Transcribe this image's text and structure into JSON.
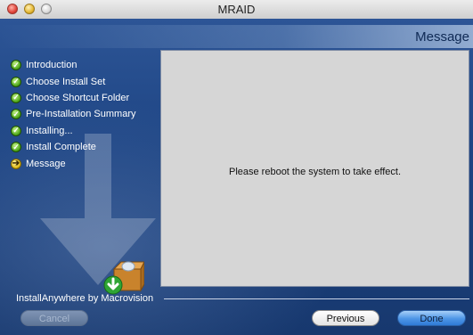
{
  "window": {
    "title": "MRAID"
  },
  "header": {
    "title": "Message"
  },
  "steps": [
    {
      "label": "Introduction",
      "state": "done"
    },
    {
      "label": "Choose Install Set",
      "state": "done"
    },
    {
      "label": "Choose Shortcut Folder",
      "state": "done"
    },
    {
      "label": "Pre-Installation Summary",
      "state": "done"
    },
    {
      "label": "Installing...",
      "state": "done"
    },
    {
      "label": "Install Complete",
      "state": "done"
    },
    {
      "label": "Message",
      "state": "current"
    }
  ],
  "content": {
    "message": "Please reboot the system to take effect."
  },
  "footer": {
    "brand": "InstallAnywhere by Macrovision"
  },
  "buttons": {
    "cancel": "Cancel",
    "previous": "Previous",
    "done": "Done"
  },
  "icons": {
    "step_done": "check-circle-icon",
    "step_current": "arrow-right-circle-icon",
    "installer_box": "installer-box-icon"
  },
  "colors": {
    "background": "#1d3f7a",
    "content_panel": "#d6d6d6",
    "done_button": "#4d95e6"
  }
}
